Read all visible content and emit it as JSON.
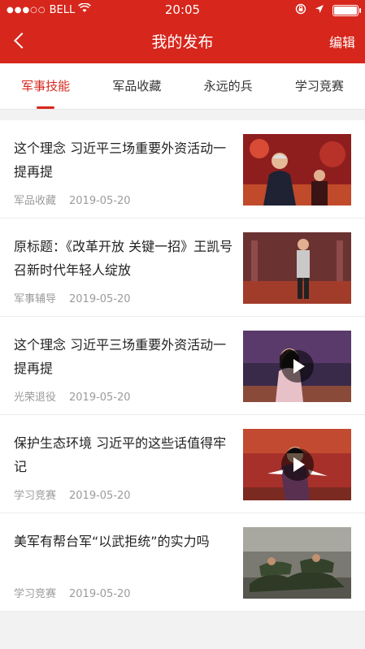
{
  "status_bar": {
    "carrier": "BELL",
    "time": "20:05"
  },
  "navbar": {
    "title": "我的发布",
    "edit_label": "编辑"
  },
  "tabs": [
    {
      "label": "军事技能",
      "active": true
    },
    {
      "label": "军品收藏",
      "active": false
    },
    {
      "label": "永远的兵",
      "active": false
    },
    {
      "label": "学习竞赛",
      "active": false
    }
  ],
  "items": [
    {
      "title": "这个理念 习近平三场重要外资活动一提再提",
      "category": "军品收藏",
      "date": "2019-05-20",
      "has_video": false
    },
    {
      "title": "原标题：《改革开放 关键一招》王凯号召新时代年轻人绽放",
      "category": "军事辅导",
      "date": "2019-05-20",
      "has_video": false
    },
    {
      "title": "这个理念 习近平三场重要外资活动一提再提",
      "category": "光荣退役",
      "date": "2019-05-20",
      "has_video": true
    },
    {
      "title": "保护生态环境 习近平的这些话值得牢记",
      "category": "学习竞赛",
      "date": "2019-05-20",
      "has_video": true
    },
    {
      "title": "美军有帮台军“以武拒统”的实力吗",
      "category": "学习竞赛",
      "date": "2019-05-20",
      "has_video": false
    }
  ],
  "colors": {
    "brand": "#d7261c",
    "battery_level": 1.0
  }
}
